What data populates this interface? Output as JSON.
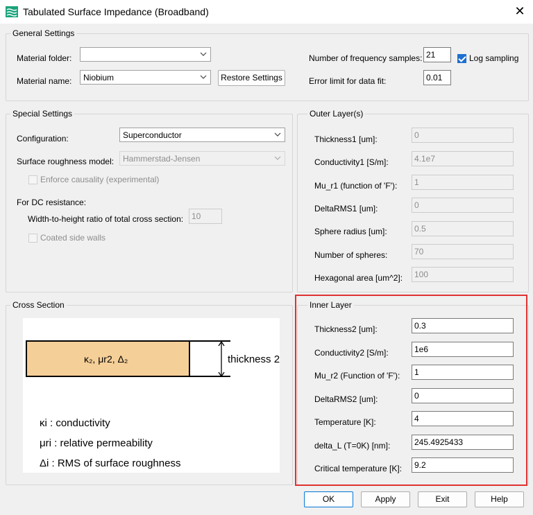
{
  "window": {
    "title": "Tabulated Surface Impedance (Broadband)",
    "close_glyph": "✕"
  },
  "general": {
    "legend": "General Settings",
    "material_folder_label": "Material folder:",
    "material_folder_value": "",
    "material_name_label": "Material name:",
    "material_name_value": "Niobium",
    "restore_button": "Restore Settings",
    "num_freq_label": "Number of frequency samples:",
    "num_freq_value": "21",
    "log_sampling_label": "Log sampling",
    "log_sampling_checked": true,
    "error_limit_label": "Error limit for data fit:",
    "error_limit_value": "0.01"
  },
  "special": {
    "legend": "Special Settings",
    "configuration_label": "Configuration:",
    "configuration_value": "Superconductor",
    "roughness_label": "Surface roughness model:",
    "roughness_value": "Hammerstad-Jensen",
    "enforce_causality_label": "Enforce causality (experimental)",
    "dc_resistance_label": "For DC resistance:",
    "width_height_label": "Width-to-height ratio of total cross section:",
    "width_height_value": "10",
    "coated_side_walls_label": "Coated side walls"
  },
  "outer": {
    "legend": "Outer Layer(s)",
    "fields": [
      {
        "label": "Thickness1 [um]:",
        "value": "0"
      },
      {
        "label": "Conductivity1 [S/m]:",
        "value": "4.1e7"
      },
      {
        "label": "Mu_r1 (function of 'F'):",
        "value": "1"
      },
      {
        "label": "DeltaRMS1 [um]:",
        "value": "0"
      },
      {
        "label": "Sphere radius [um]:",
        "value": "0.5"
      },
      {
        "label": "Number of spheres:",
        "value": "70"
      },
      {
        "label": "Hexagonal area [um^2]:",
        "value": "100"
      }
    ]
  },
  "cross_section": {
    "legend": "Cross Section",
    "layer_label": "κ₂, μr2, Δ₂",
    "thickness_label": "thickness 2",
    "legend_lines": [
      "κi : conductivity",
      "μri : relative permeability",
      "Δi : RMS of surface roughness"
    ]
  },
  "inner": {
    "legend": "Inner Layer",
    "fields": [
      {
        "label": "Thickness2 [um]:",
        "value": "0.3"
      },
      {
        "label": "Conductivity2 [S/m]:",
        "value": "1e6"
      },
      {
        "label": "Mu_r2 (Function of 'F'):",
        "value": "1"
      },
      {
        "label": "DeltaRMS2 [um]:",
        "value": "0"
      },
      {
        "label": "Temperature [K]:",
        "value": "4"
      },
      {
        "label": "delta_L (T=0K) [nm]:",
        "value": "245.4925433"
      },
      {
        "label": "Critical temperature [K]:",
        "value": "9.2"
      }
    ]
  },
  "buttons": {
    "ok": "OK",
    "apply": "Apply",
    "exit": "Exit",
    "help": "Help"
  },
  "colors": {
    "highlight": "#e03131",
    "layer_fill": "#f5cf98",
    "accent": "#1f6fcf"
  }
}
